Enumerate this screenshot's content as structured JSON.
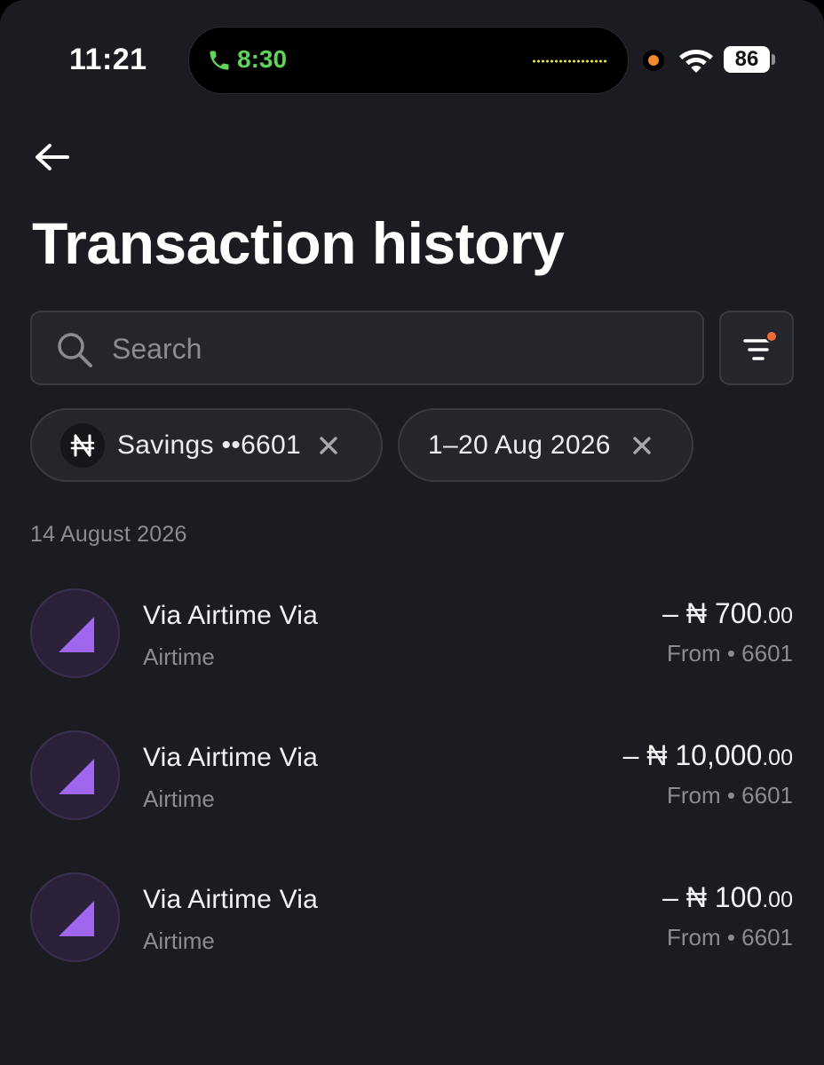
{
  "status_bar": {
    "time": "11:21",
    "call_timer": "8:30",
    "battery": "86",
    "call_color": "#5fd35a",
    "recording_dot_color": "#f08a30"
  },
  "header": {
    "back_icon": "arrow-left-icon",
    "title": "Transaction history"
  },
  "search": {
    "placeholder": "Search",
    "value": ""
  },
  "filter": {
    "icon": "filter-icon",
    "active_dot_color": "#f06a3a"
  },
  "chips": [
    {
      "icon": "naira-icon",
      "label": "Savings ••6601"
    },
    {
      "label": "1–20 Aug 2026"
    }
  ],
  "groups": [
    {
      "date": "14 August 2026",
      "transactions": [
        {
          "name": "Via Airtime Via",
          "category": "Airtime",
          "amount_main": "– ₦ 700",
          "amount_decimal": ".00",
          "source": "From • 6601"
        },
        {
          "name": "Via Airtime Via",
          "category": "Airtime",
          "amount_main": "– ₦ 10,000",
          "amount_decimal": ".00",
          "source": "From • 6601"
        },
        {
          "name": "Via Airtime Via",
          "category": "Airtime",
          "amount_main": "– ₦ 100",
          "amount_decimal": ".00",
          "source": "From • 6601"
        }
      ]
    }
  ],
  "colors": {
    "background": "#1b1c21",
    "surface": "#25262c",
    "accent_purple": "#a066f0",
    "muted_text": "#8b8c93"
  }
}
